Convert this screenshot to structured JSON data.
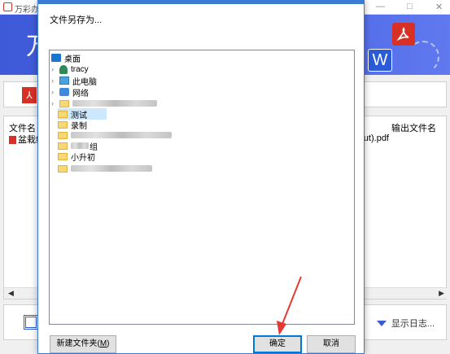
{
  "app": {
    "title": "万彩办公",
    "banner_title": "万",
    "pdf_tile": "⅄",
    "w_tile": "W"
  },
  "filelist": {
    "col_filename": "文件名",
    "col_output": "输出文件名",
    "row_file": "盆栽绿",
    "row_output": "(cut).pdf"
  },
  "bottombar": {
    "log_label": "显示日志..."
  },
  "dialog": {
    "title": "文件另存为...",
    "tree": {
      "desktop": "桌面",
      "user": "tracy",
      "pc": "此电脑",
      "network": "网络",
      "test": "测试",
      "record": "录制",
      "group": "组",
      "primary": "小升初"
    },
    "new_folder_label": "新建文件夹(",
    "new_folder_key": "M",
    "new_folder_close": ")",
    "ok_label": "确定",
    "cancel_label": "取消"
  },
  "colors": {
    "banner": "#4a65e6",
    "accent": "#0078d7",
    "selection": "#cce8ff",
    "annotation": "#e53935"
  }
}
